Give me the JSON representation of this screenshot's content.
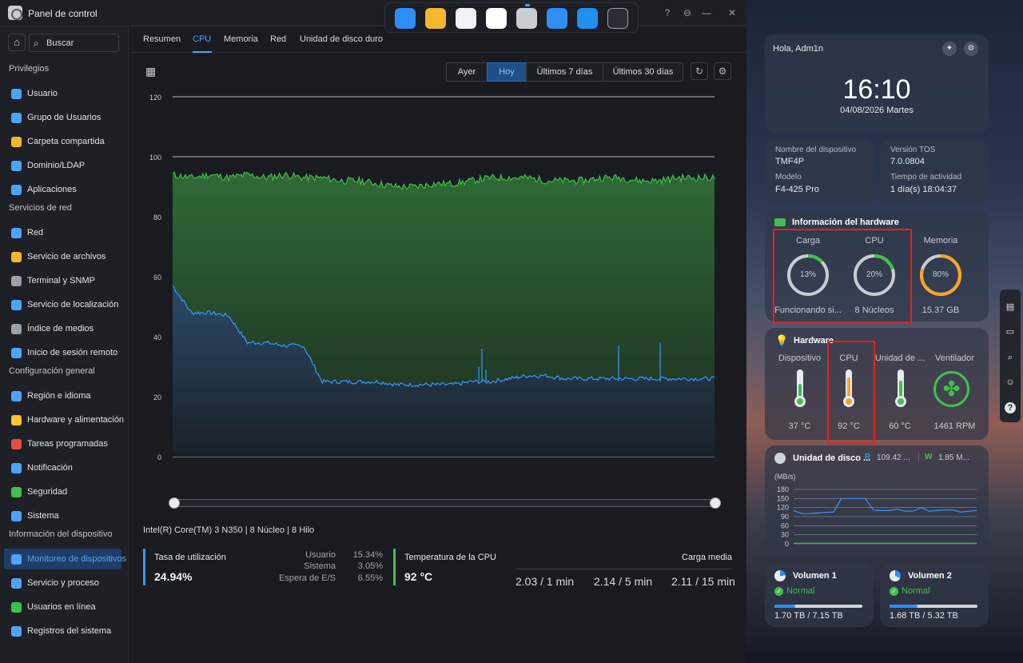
{
  "window": {
    "title": "Panel de control",
    "controls": [
      "?",
      "⊖",
      "—",
      "☐",
      "✕"
    ]
  },
  "dock": {
    "apps": [
      "layout-app-icon",
      "files-app-icon",
      "apps-grid-icon",
      "clock-app-icon",
      "control-panel-app-icon",
      "storage-app-icon",
      "store-app-icon",
      "terminal-app-icon"
    ]
  },
  "sidebar": {
    "search_placeholder": "Buscar",
    "sections": [
      {
        "title": "Privilegios",
        "items": [
          "Usuario",
          "Grupo de Usuarios",
          "Carpeta compartida",
          "Dominio/LDAP",
          "Aplicaciones"
        ]
      },
      {
        "title": "Servicios de red",
        "items": [
          "Red",
          "Servicio de archivos",
          "Terminal y SNMP",
          "Servicio de localización",
          "Índice de medios",
          "Inicio de sesión remoto"
        ]
      },
      {
        "title": "Configuración general",
        "items": [
          "Región e idioma",
          "Hardware y alimentación",
          "Tareas programadas",
          "Notificación",
          "Seguridad",
          "Sistema"
        ]
      },
      {
        "title": "Información del dispositivo",
        "items": [
          "Monitoreo de dispositivos",
          "Servicio y proceso",
          "Usuarios en línea",
          "Registros del sistema"
        ]
      }
    ],
    "active_item": "Monitoreo de dispositivos"
  },
  "tabs": [
    "Resumen",
    "CPU",
    "Memoria",
    "Red",
    "Unidad de disco duro"
  ],
  "active_tab": "CPU",
  "range_buttons": [
    "Ayer",
    "Hoy",
    "Últimos 7 días",
    "Últimos 30 días"
  ],
  "active_range": "Hoy",
  "chart_data": {
    "type": "area",
    "y_ticks": [
      "120",
      "100",
      "80",
      "60",
      "40",
      "20",
      "0"
    ],
    "ylim": [
      0,
      120
    ],
    "grid": true,
    "series": [
      {
        "color": "#3fc04a",
        "description_values": "approx 92-94 throughout, dips to ~89-91 in the middle",
        "values": [
          94,
          93,
          94,
          93,
          94,
          93,
          94,
          93,
          93,
          92,
          92,
          91,
          90,
          90,
          91,
          91,
          92,
          93,
          93,
          93,
          92,
          92,
          92,
          93,
          93,
          92,
          92,
          93,
          93,
          93
        ]
      },
      {
        "color": "#3a96ff",
        "values": [
          57,
          48,
          48,
          47,
          38,
          38,
          37,
          37,
          25,
          25,
          25,
          25,
          24,
          24,
          24,
          24,
          25,
          25,
          26,
          27,
          27,
          26,
          26,
          26,
          26,
          26,
          26,
          26,
          26,
          26
        ]
      }
    ]
  },
  "cpu_info": "Intel(R) Core(TM) 3 N350 | 8 Núcleo | 8 Hilo",
  "stats": {
    "usage_label": "Tasa de utilización",
    "usage_value": "24.94%",
    "user_label": "Usuario",
    "user_value": "15.34%",
    "system_label": "Sistema",
    "system_value": "3.05%",
    "io_label": "Espera de E/S",
    "io_value": "6.55%",
    "temp_label": "Temperatura de la CPU",
    "temp_value": "92 °C",
    "load_label": "Carga media",
    "load1": "2.03 / 1 min",
    "load5": "2.14 / 5 min",
    "load15": "2.11 / 15 min"
  },
  "widgets": {
    "greeting": "Hola, Adm1n",
    "time": "16:10",
    "date": "04/08/2026 Martes",
    "device_name_label": "Nombre del dispositivo",
    "device_name": "TMF4P",
    "tos_label": "Versión TOS",
    "tos_value": "7.0.0804",
    "model_label": "Modelo",
    "model_value": "F4-425 Pro",
    "uptime_label": "Tiempo de actividad",
    "uptime_value": "1 día(s) 18:04:37",
    "hw_info_title": "Información del hardware",
    "load_title": "Carga",
    "load_pct": "13%",
    "load_sub": "Funcionando si...",
    "cpu_title": "CPU",
    "cpu_pct": "20%",
    "cpu_sub": "8 Núcleos",
    "mem_title": "Memoria",
    "mem_pct": "80%",
    "mem_sub": "15.37 GB",
    "gauges": {
      "load": 0.13,
      "cpu": 0.2,
      "mem": 0.8
    },
    "hardware_title": "Hardware",
    "hw_device_label": "Dispositivo",
    "hw_device_temp": "37 °C",
    "hw_cpu_label": "CPU",
    "hw_cpu_temp": "92 °C",
    "hw_disk_label": "Unidad de ...",
    "hw_disk_temp": "60 °C",
    "hw_fan_label": "Ventilador",
    "hw_fan_rpm": "1461 RPM",
    "disk_title": "Unidad de disco ...",
    "disk_read_badge": "R",
    "disk_read": "109.42 ...",
    "disk_write_badge": "W",
    "disk_write": "1.85 M...",
    "disk_unit": "(MB/s)",
    "disk_y_ticks": [
      "180",
      "150",
      "120",
      "90",
      "60",
      "30",
      "0"
    ],
    "disk_chart": {
      "type": "line",
      "ylim": [
        0,
        180
      ],
      "series": [
        {
          "color": "#3a96ff",
          "values": [
            110,
            100,
            100,
            102,
            104,
            105,
            150,
            150,
            150,
            150,
            112,
            110,
            110,
            115,
            108,
            108,
            120,
            108,
            110,
            112,
            112,
            105,
            108,
            110
          ]
        },
        {
          "color": "#3fc04a",
          "values": [
            2,
            2,
            2,
            2,
            2,
            2,
            2,
            2,
            2,
            2,
            2,
            2,
            2,
            2,
            2,
            2,
            2,
            2,
            2,
            2,
            2,
            2,
            2,
            2
          ]
        }
      ]
    },
    "vol1_title": "Volumen 1",
    "vol1_status": "Normal",
    "vol1_size": "1.70 TB / 7.15 TB",
    "vol1_fill": 0.24,
    "vol2_title": "Volumen 2",
    "vol2_status": "Normal",
    "vol2_size": "1.68 TB / 5.32 TB",
    "vol2_fill": 0.32
  },
  "right_toolbar": [
    "chart-icon",
    "chat-icon",
    "search-icon",
    "robot-icon",
    "help-icon"
  ]
}
